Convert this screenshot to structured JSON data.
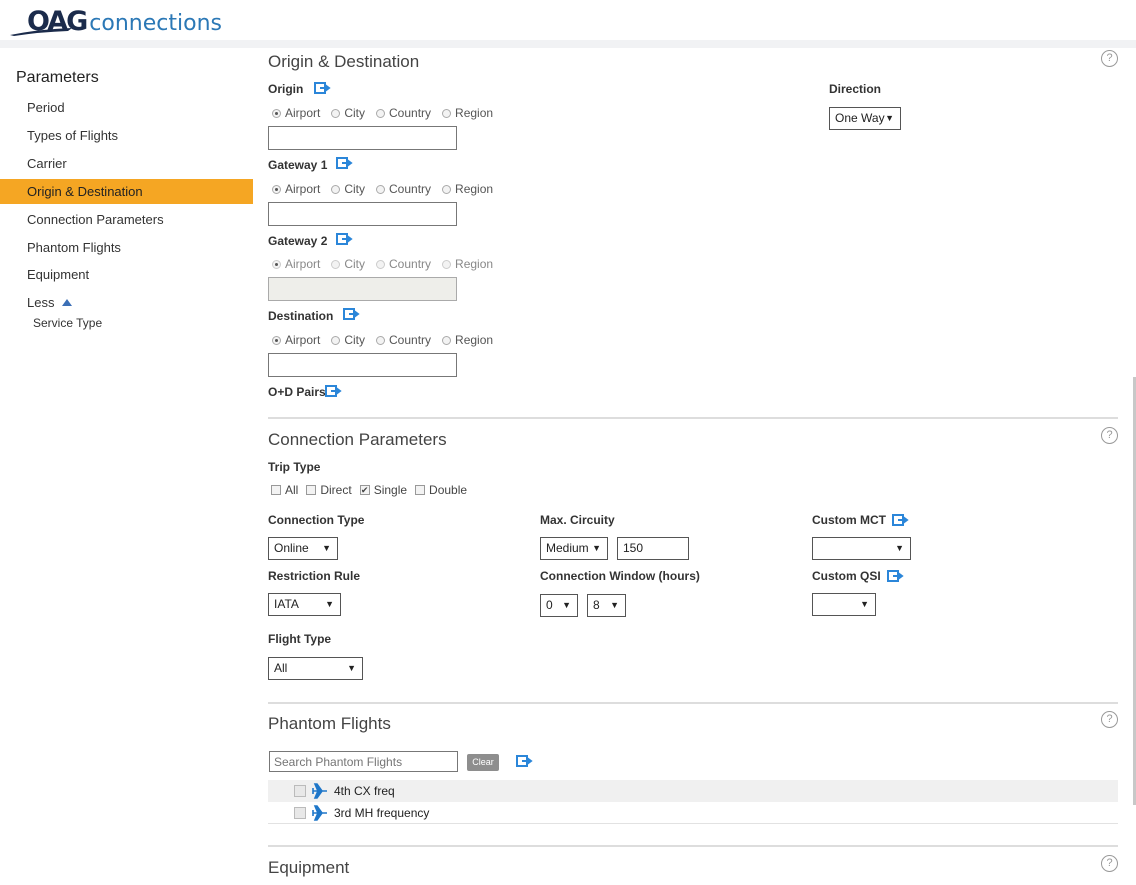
{
  "header": {
    "logo_primary": "OAG",
    "logo_secondary": "connections"
  },
  "sidebar": {
    "title": "Parameters",
    "items": [
      {
        "label": "Period"
      },
      {
        "label": "Types of Flights"
      },
      {
        "label": "Carrier"
      },
      {
        "label": "Origin & Destination",
        "active": true
      },
      {
        "label": "Connection Parameters"
      },
      {
        "label": "Phantom Flights"
      },
      {
        "label": "Equipment"
      },
      {
        "label": "Less"
      }
    ],
    "sub_items": [
      {
        "label": "Service Type"
      }
    ]
  },
  "origin_destination": {
    "title": "Origin & Destination",
    "radio_options": [
      "Airport",
      "City",
      "Country",
      "Region"
    ],
    "origin": {
      "label": "Origin",
      "selected": "Airport",
      "value": ""
    },
    "gateway1": {
      "label": "Gateway 1",
      "selected": "Airport",
      "value": ""
    },
    "gateway2": {
      "label": "Gateway 2",
      "selected": "Airport",
      "value": "",
      "disabled": true
    },
    "destination": {
      "label": "Destination",
      "selected": "Airport",
      "value": ""
    },
    "od_pairs": {
      "label": "O+D Pairs"
    },
    "direction": {
      "label": "Direction",
      "value": "One Way"
    }
  },
  "connection_parameters": {
    "title": "Connection Parameters",
    "trip_type": {
      "label": "Trip Type",
      "options": [
        {
          "label": "All",
          "checked": false
        },
        {
          "label": "Direct",
          "checked": false
        },
        {
          "label": "Single",
          "checked": true
        },
        {
          "label": "Double",
          "checked": false
        }
      ]
    },
    "connection_type": {
      "label": "Connection Type",
      "value": "Online"
    },
    "max_circuity": {
      "label": "Max. Circuity",
      "value": "Medium",
      "number": "150"
    },
    "custom_mct": {
      "label": "Custom MCT",
      "value": ""
    },
    "restriction_rule": {
      "label": "Restriction Rule",
      "value": "IATA"
    },
    "connection_window": {
      "label": "Connection Window (hours)",
      "min": "0",
      "max": "8"
    },
    "custom_qsi": {
      "label": "Custom QSI",
      "value": ""
    },
    "flight_type": {
      "label": "Flight Type",
      "value": "All"
    }
  },
  "phantom_flights": {
    "title": "Phantom Flights",
    "search_placeholder": "Search Phantom Flights",
    "clear_label": "Clear",
    "items": [
      {
        "label": "4th CX freq"
      },
      {
        "label": "3rd MH frequency"
      }
    ]
  },
  "equipment": {
    "title": "Equipment"
  },
  "icons": {
    "help": "?",
    "dropdown": "▼",
    "check": "✔"
  },
  "colors": {
    "active_nav": "#f5a623",
    "accent_blue": "#2b86d9"
  }
}
